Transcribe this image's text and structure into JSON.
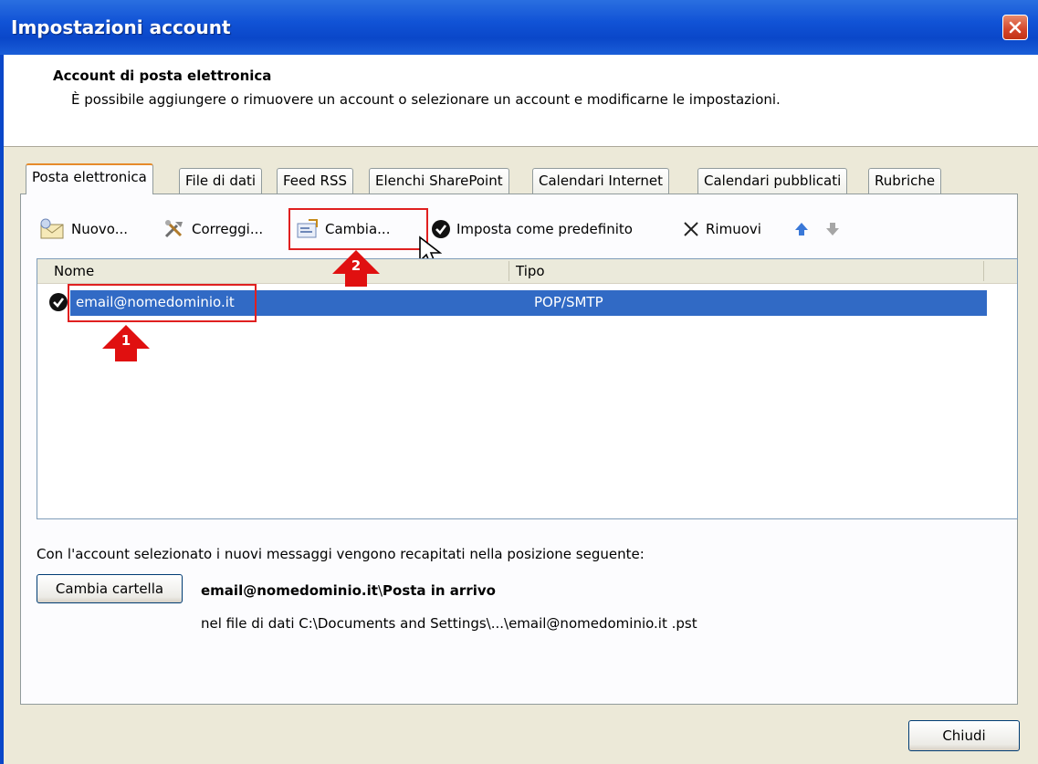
{
  "window": {
    "title": "Impostazioni account",
    "close_icon": "close-icon"
  },
  "header": {
    "title": "Account di posta elettronica",
    "description": "È possibile aggiungere o rimuovere un account o selezionare un account e modificarne le impostazioni."
  },
  "tabs": [
    {
      "label": "Posta elettronica",
      "active": true
    },
    {
      "label": "File di dati"
    },
    {
      "label": "Feed RSS"
    },
    {
      "label": "Elenchi SharePoint"
    },
    {
      "label": "Calendari Internet"
    },
    {
      "label": "Calendari pubblicati"
    },
    {
      "label": "Rubriche"
    }
  ],
  "toolbar": {
    "new_label": "Nuovo...",
    "repair_label": "Correggi...",
    "change_label": "Cambia...",
    "set_default_label": "Imposta come predefinito",
    "remove_label": "Rimuovi"
  },
  "accounts_list": {
    "columns": [
      "Nome",
      "Tipo"
    ],
    "rows": [
      {
        "name": "email@nomedominio.it",
        "type": "POP/SMTP",
        "selected": true,
        "default": true
      }
    ]
  },
  "annotations": {
    "marker_1": "1",
    "marker_2": "2",
    "color": "#e02020"
  },
  "delivery": {
    "description": "Con l'account selezionato i nuovi messaggi vengono recapitati nella posizione seguente:",
    "change_folder_label": "Cambia cartella",
    "folder_account": "email@nomedominio.it",
    "folder_separator": "\\",
    "folder_name": "Posta in arrivo",
    "data_file": "nel file di dati C:\\Documents and Settings\\...\\email@nomedominio.it .pst"
  },
  "footer": {
    "close_label": "Chiudi"
  },
  "colors": {
    "titlebar": "#0a47c9",
    "selection": "#316ac5",
    "dialog_bg": "#ece9d8"
  }
}
